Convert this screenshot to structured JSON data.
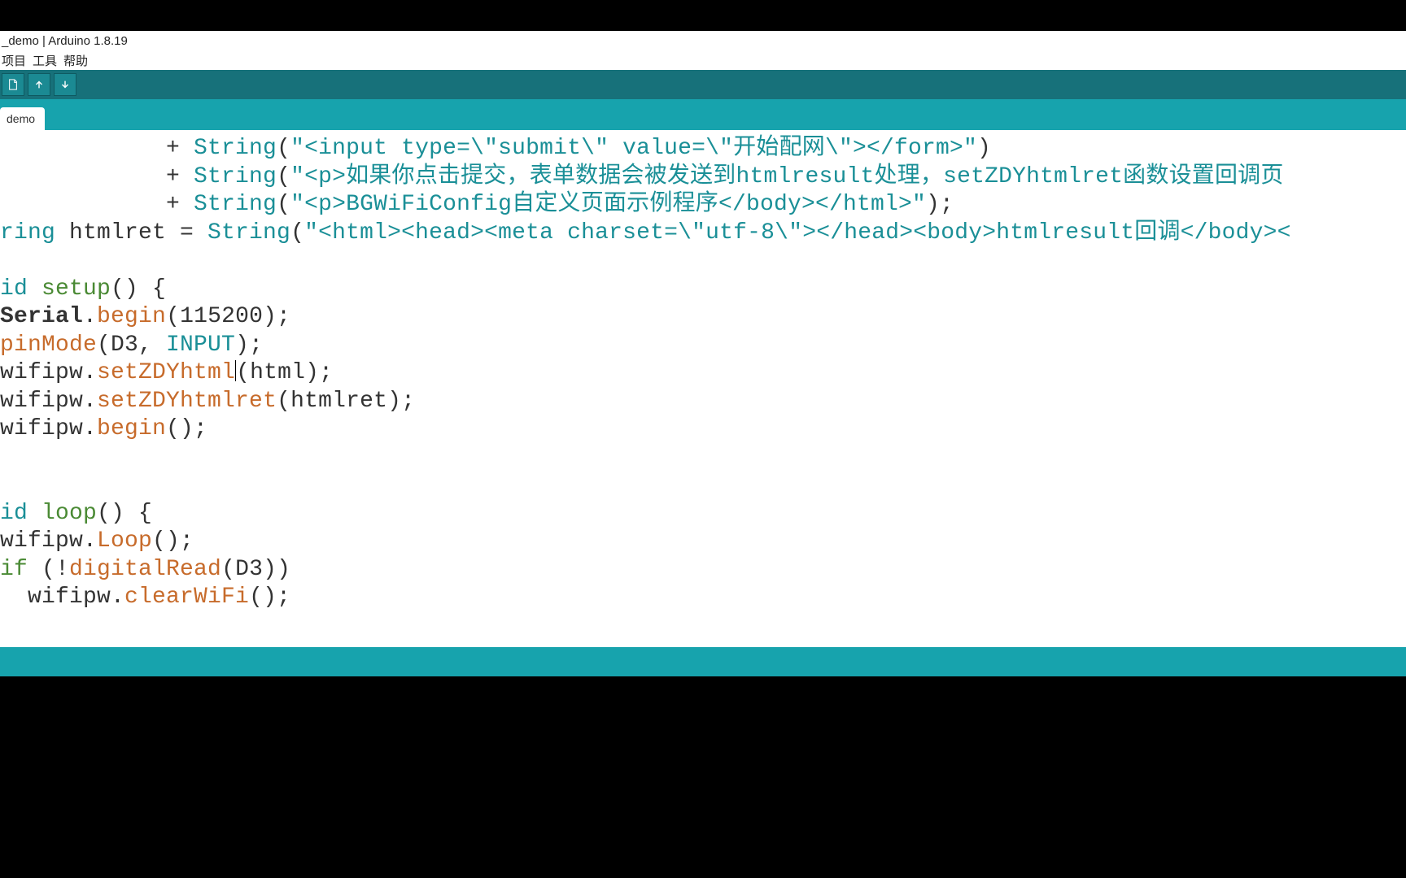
{
  "window": {
    "title": "_demo | Arduino 1.8.19"
  },
  "menu": {
    "project": "项目",
    "tools": "工具",
    "help": "帮助"
  },
  "toolbar": {
    "new_icon": "new-icon",
    "upload_icon": "upload-icon",
    "download_icon": "download-icon"
  },
  "tabs": {
    "active": "demo"
  },
  "code": {
    "l1_a": "            + ",
    "l1_b": "String",
    "l1_c": "(",
    "l1_d": "\"<input type=\\\"submit\\\" value=\\\"开始配网\\\"></form>\"",
    "l1_e": ")",
    "l2_a": "            + ",
    "l2_b": "String",
    "l2_c": "(",
    "l2_d": "\"<p>如果你点击提交，表单数据会被发送到htmlresult处理，setZDYhtmlret函数设置回调页",
    "l2_e": "",
    "l3_a": "            + ",
    "l3_b": "String",
    "l3_c": "(",
    "l3_d": "\"<p>BGWiFiConfig自定义页面示例程序</body></html>\"",
    "l3_e": ");",
    "l4_a": "ring",
    "l4_b": " htmlret = ",
    "l4_c": "String",
    "l4_d": "(",
    "l4_e": "\"<html><head><meta charset=\\\"utf-8\\\"></head><body>htmlresult回调</body><",
    "l4_f": "",
    "l5": "",
    "l6_a": "id",
    "l6_b": " ",
    "l6_c": "setup",
    "l6_d": "() {",
    "l7_a": "Serial",
    "l7_b": ".",
    "l7_c": "begin",
    "l7_d": "(115200);",
    "l8_a": "pinMode",
    "l8_b": "(D3, ",
    "l8_c": "INPUT",
    "l8_d": ");",
    "l9_a": "wifipw.",
    "l9_b": "setZDYhtml",
    "l9_c": "(html);",
    "l10_a": "wifipw.",
    "l10_b": "setZDYhtmlret",
    "l10_c": "(htmlret);",
    "l11_a": "wifipw.",
    "l11_b": "begin",
    "l11_c": "();",
    "l12": "",
    "l13": "",
    "l14_a": "id",
    "l14_b": " ",
    "l14_c": "loop",
    "l14_d": "() {",
    "l15_a": "wifipw.",
    "l15_b": "Loop",
    "l15_c": "();",
    "l16_a": "if",
    "l16_b": " (!",
    "l16_c": "digitalRead",
    "l16_d": "(D3))",
    "l17_a": "  wifipw.",
    "l17_b": "clearWiFi",
    "l17_c": "();"
  }
}
